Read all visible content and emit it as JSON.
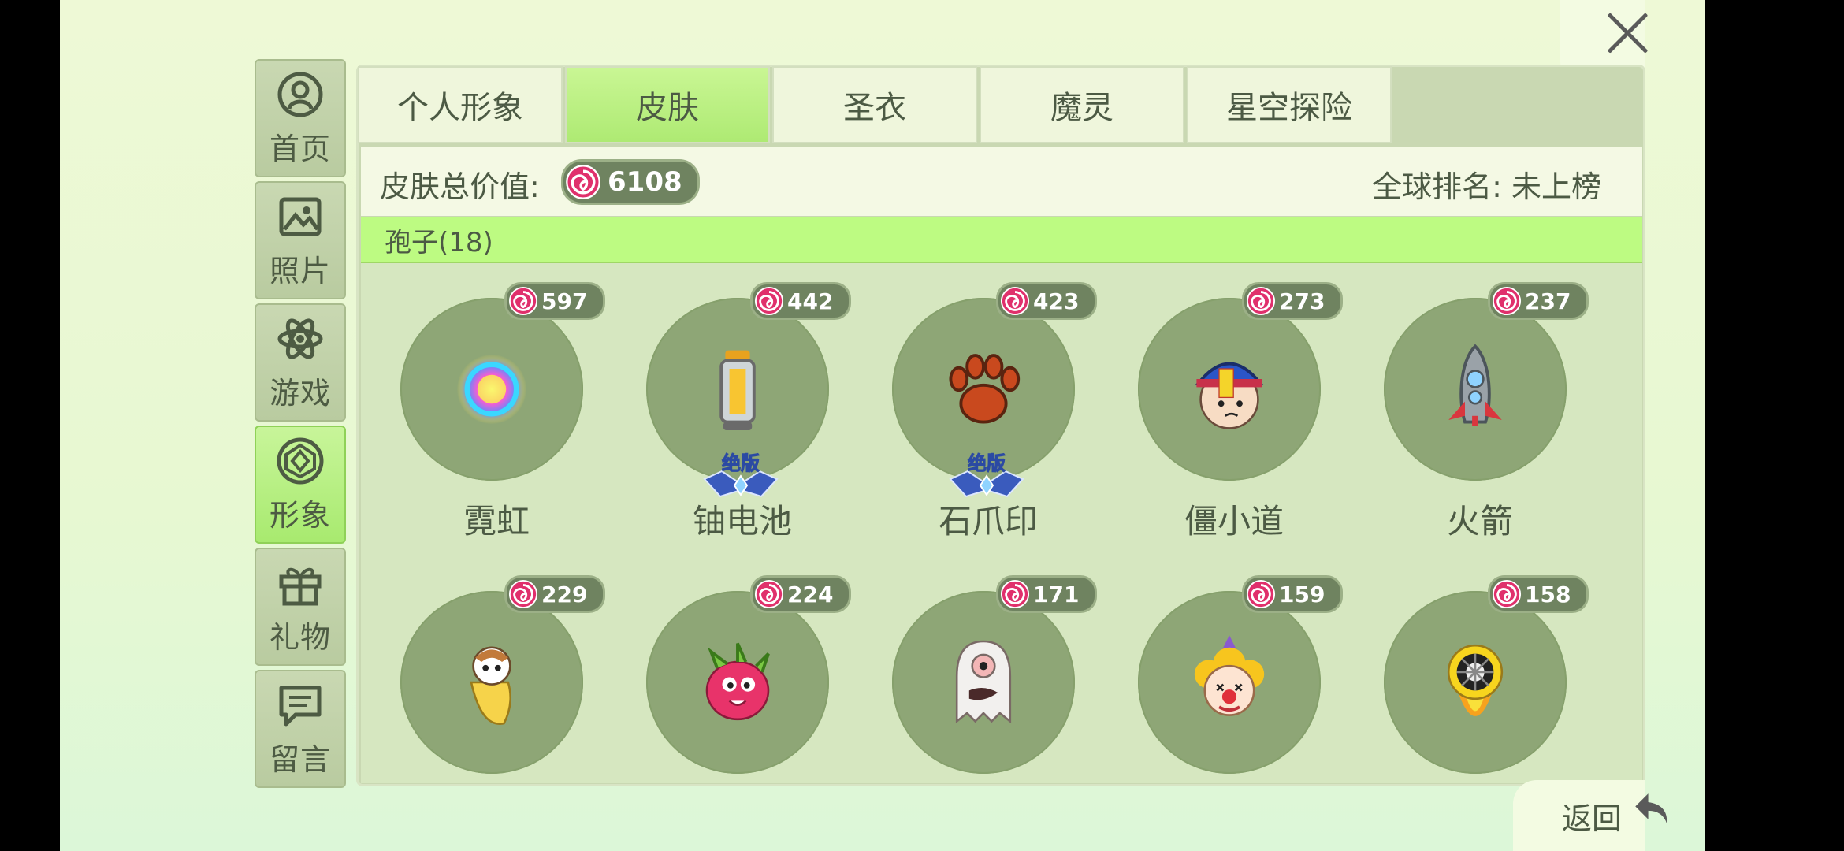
{
  "close_label": "",
  "sidebar": {
    "items": [
      {
        "label": "首页",
        "icon": "home-user-icon"
      },
      {
        "label": "照片",
        "icon": "photo-icon"
      },
      {
        "label": "游戏",
        "icon": "atom-icon"
      },
      {
        "label": "形象",
        "icon": "gem-icon",
        "active": true
      },
      {
        "label": "礼物",
        "icon": "gift-icon"
      },
      {
        "label": "留言",
        "icon": "message-icon"
      }
    ]
  },
  "tabs": [
    {
      "label": "个人形象"
    },
    {
      "label": "皮肤",
      "active": true
    },
    {
      "label": "圣衣"
    },
    {
      "label": "魔灵"
    },
    {
      "label": "星空探险"
    }
  ],
  "summary": {
    "label": "皮肤总价值:",
    "total": "6108",
    "rank": "全球排名: 未上榜"
  },
  "category": "孢子(18)",
  "badge_text": "绝版",
  "items": [
    {
      "name": "霓虹",
      "price": "597",
      "icon": "neon-orb-icon",
      "badge": false
    },
    {
      "name": "铀电池",
      "price": "442",
      "icon": "uranium-battery-icon",
      "badge": true
    },
    {
      "name": "石爪印",
      "price": "423",
      "icon": "paw-print-icon",
      "badge": true
    },
    {
      "name": "僵小道",
      "price": "273",
      "icon": "jiangshi-head-icon",
      "badge": false
    },
    {
      "name": "火箭",
      "price": "237",
      "icon": "rocket-icon",
      "badge": false
    },
    {
      "name": "",
      "price": "229",
      "icon": "hamster-banana-icon",
      "badge": false
    },
    {
      "name": "",
      "price": "224",
      "icon": "dragonfruit-icon",
      "badge": false
    },
    {
      "name": "",
      "price": "171",
      "icon": "ghost-icon",
      "badge": false
    },
    {
      "name": "",
      "price": "159",
      "icon": "clown-icon",
      "badge": false
    },
    {
      "name": "",
      "price": "158",
      "icon": "wheel-flame-icon",
      "badge": false
    }
  ],
  "back_label": "返回",
  "colors": {
    "active_tab": "#b5ec78",
    "price_pill": "#6f8360",
    "item_disc": "#8ea676",
    "candy": "#e0306c"
  }
}
